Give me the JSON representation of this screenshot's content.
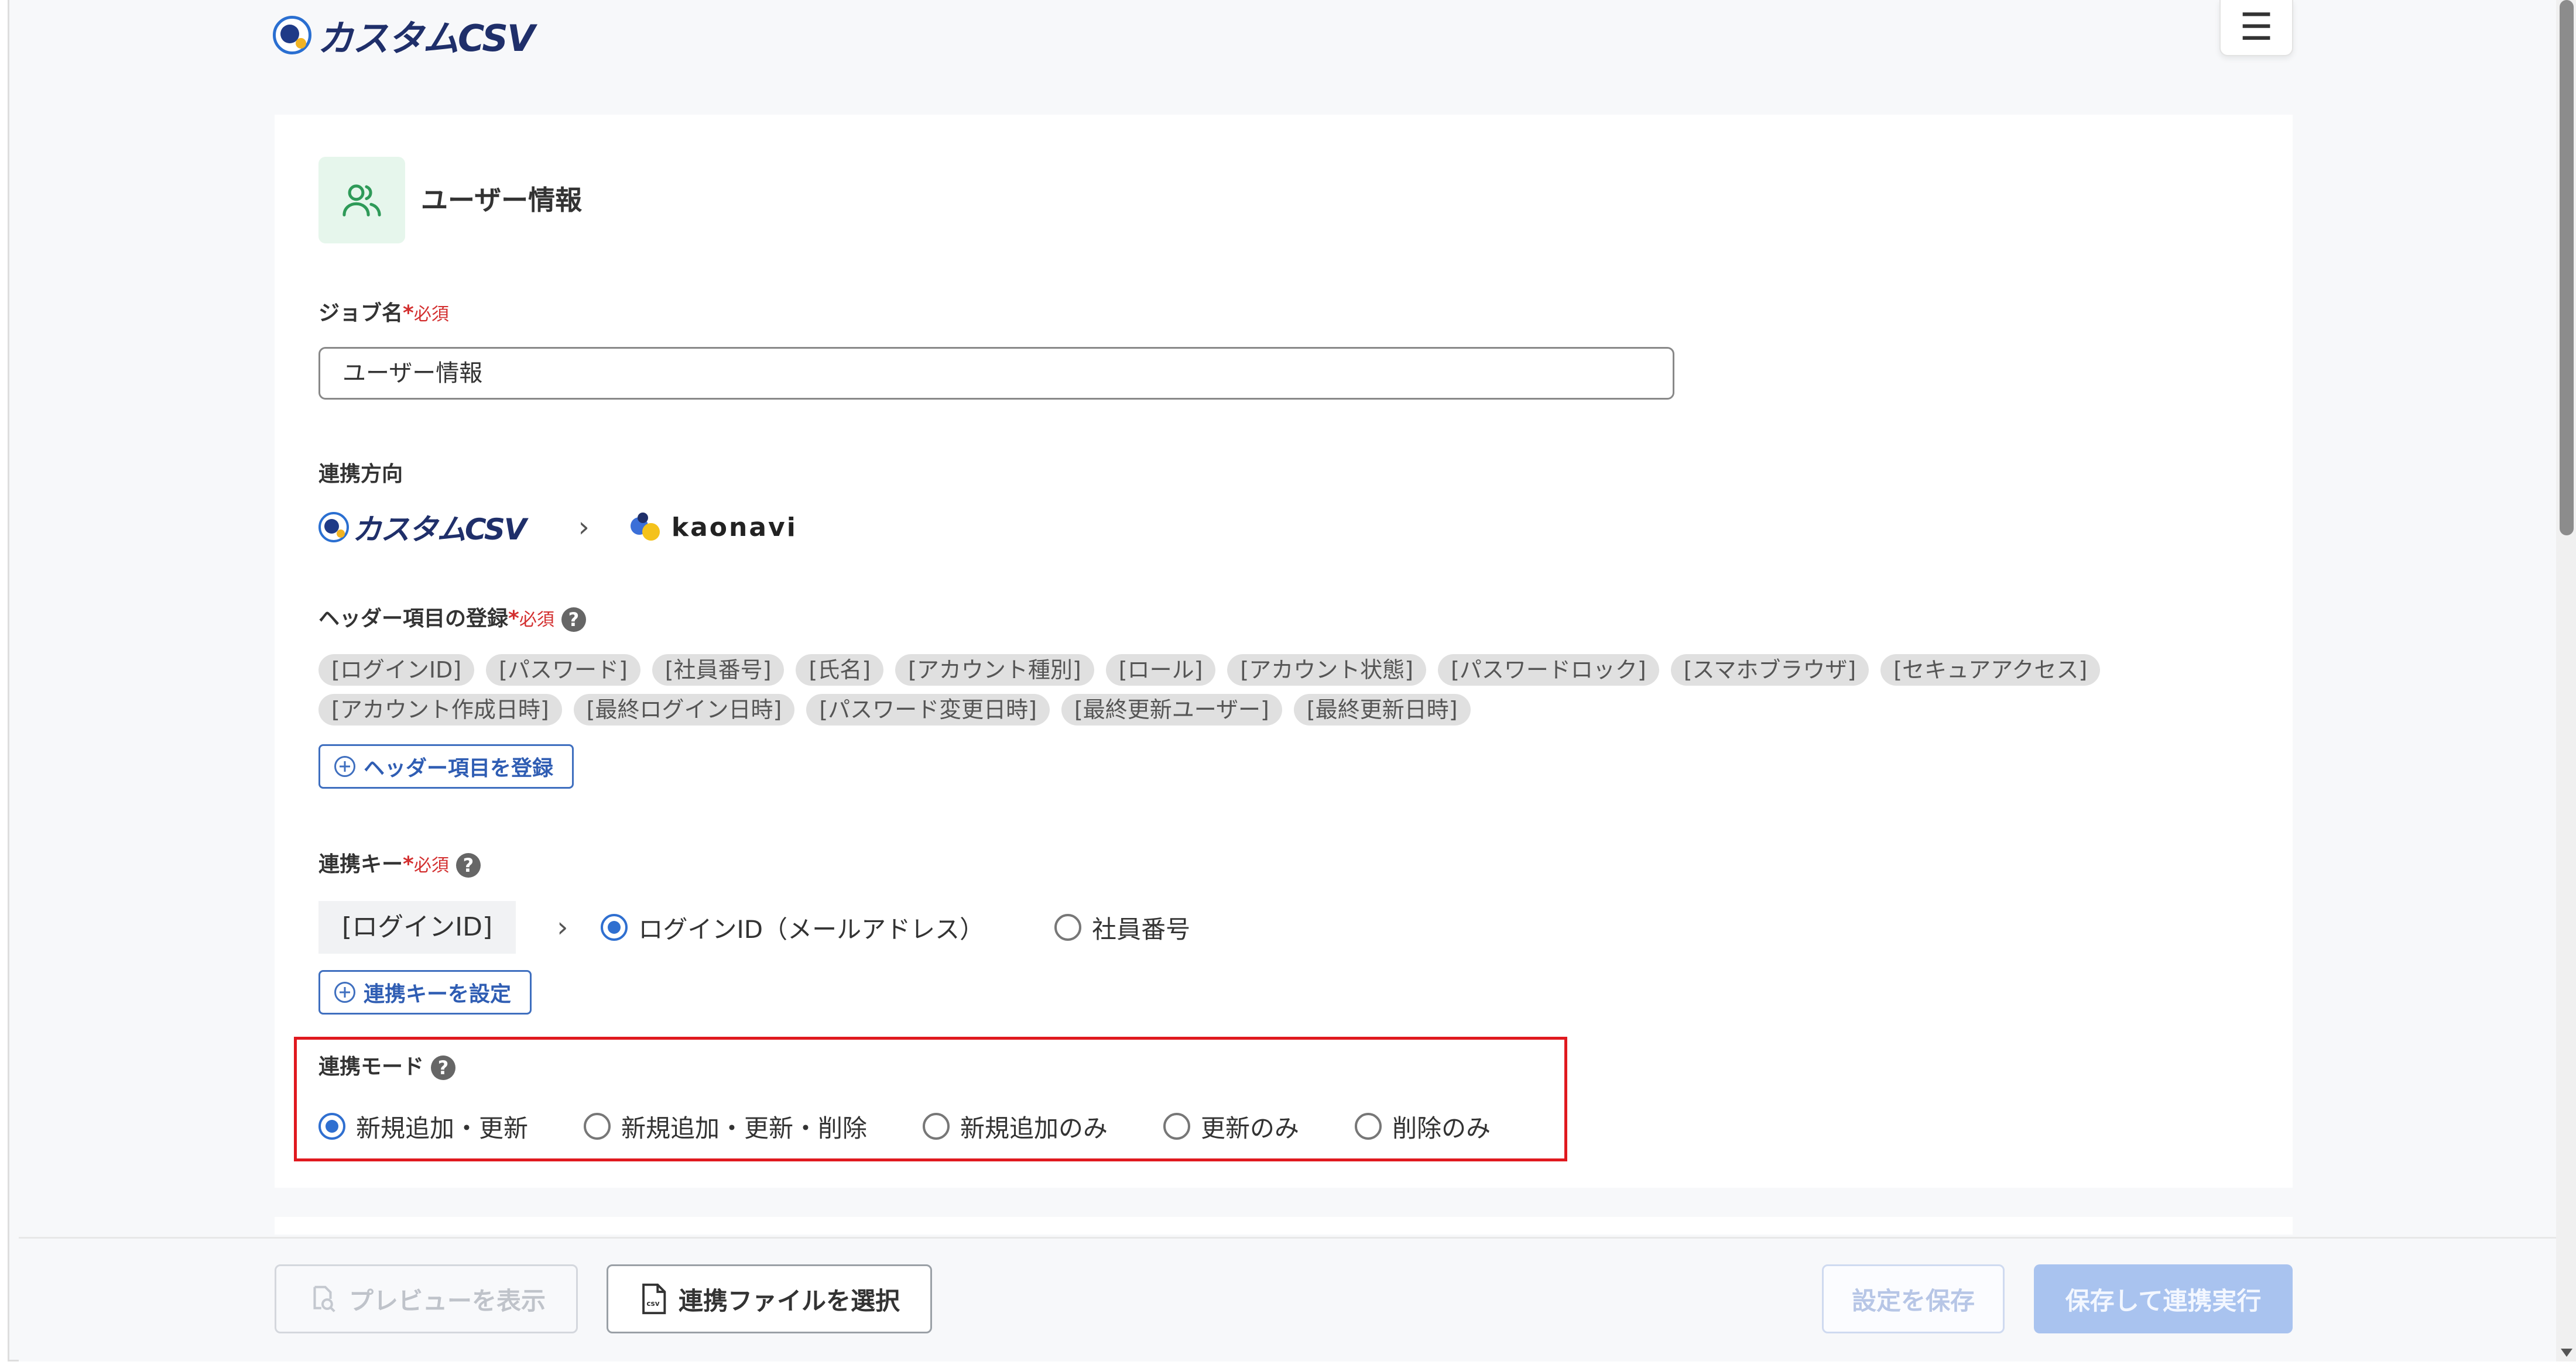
{
  "app": {
    "brand": "カスタムCSV",
    "menu_glyph": "☰"
  },
  "section": {
    "title": "ユーザー情報",
    "icon": "users-icon"
  },
  "job": {
    "label": "ジョブ名",
    "required_star": "*",
    "required": "必須",
    "value": "ユーザー情報"
  },
  "direction": {
    "label": "連携方向",
    "from": "カスタムCSV",
    "arrow": "›",
    "to": "kaonavi"
  },
  "headers": {
    "label": "ヘッダー項目の登録",
    "required_star": "*",
    "required": "必須",
    "tags": [
      "[ログインID]",
      "[パスワード]",
      "[社員番号]",
      "[氏名]",
      "[アカウント種別]",
      "[ロール]",
      "[アカウント状態]",
      "[パスワードロック]",
      "[スマホブラウザ]",
      "[セキュアアクセス]",
      "[アカウント作成日時]",
      "[最終ログイン日時]",
      "[パスワード変更日時]",
      "[最終更新ユーザー]",
      "[最終更新日時]"
    ],
    "button": "ヘッダー項目を登録"
  },
  "key": {
    "label": "連携キー",
    "required_star": "*",
    "required": "必須",
    "source": "[ログインID]",
    "arrow": "›",
    "options": [
      "ログインID（メールアドレス）",
      "社員番号"
    ],
    "selected": 0,
    "button": "連携キーを設定"
  },
  "mode": {
    "label": "連携モード",
    "options": [
      "新規追加・更新",
      "新規追加・更新・削除",
      "新規追加のみ",
      "更新のみ",
      "削除のみ"
    ],
    "selected": 0
  },
  "help_glyph": "?",
  "footer": {
    "preview": "プレビューを表示",
    "select_file": "連携ファイルを選択",
    "save": "設定を保存",
    "save_run": "保存して連携実行"
  },
  "colors": {
    "brand": "#1f2f6a",
    "accent": "#2f6fd0",
    "highlight": "#e0191f",
    "required": "#d32f2f"
  }
}
